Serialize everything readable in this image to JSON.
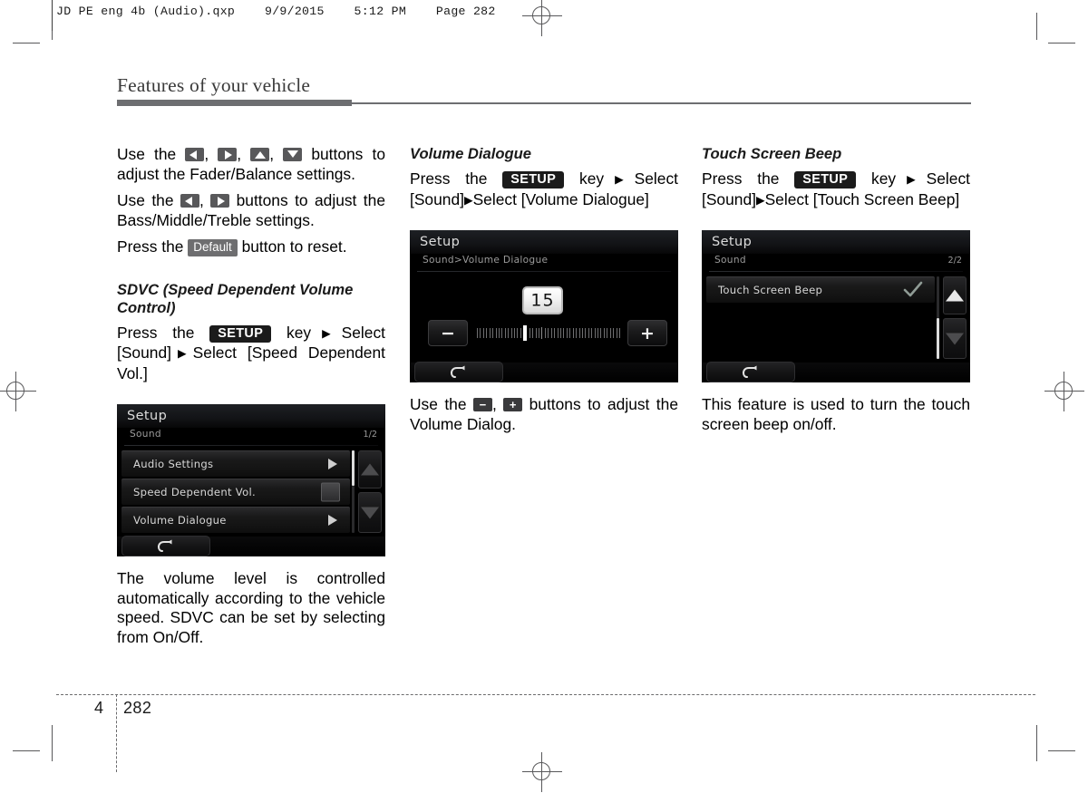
{
  "job_header": {
    "text": "JD PE eng 4b (Audio).qxp    9/9/2015    5:12 PM    Page 282"
  },
  "running_head": {
    "title": "Features of your vehicle"
  },
  "footer": {
    "chapter": "4",
    "page": "282"
  },
  "columns": {
    "col1": {
      "para1": {
        "t1": "Use the ",
        "sep1": ", ",
        "sep2": ", ",
        "sep3": ", ",
        "t2": " buttons to adjust the Fader/Balance settings."
      },
      "para2": {
        "t1": "Use the ",
        "sep1": ", ",
        "t2": " buttons to adjust the Bass/Middle/Treble settings."
      },
      "para3": {
        "t1": "Press the ",
        "chip": "Default",
        "t2": " button to reset."
      },
      "section_heading": "SDVC (Speed Dependent Volume Control)",
      "path": {
        "t1": "Press    the  ",
        "chip": "SETUP",
        "t2": "  key",
        "arrow1": "▶",
        "t3": "Select [Sound]",
        "arrow2": "▶",
        "t4": "Select [Speed Dependent Vol.]"
      },
      "caption": "The volume level is controlled automatically according to the vehicle speed. SDVC can be set by selecting from On/Off."
    },
    "col2": {
      "section_heading": "Volume Dialogue",
      "path": {
        "t1": "Press    the  ",
        "chip": "SETUP",
        "t2": "  key",
        "arrow1": "▶",
        "t3": "Select [Sound]",
        "arrow2": "▶",
        "t4": "Select [Volume Dialogue]"
      },
      "caption": {
        "t1": "Use the ",
        "sep1": ", ",
        "t2": " buttons to adjust the Volume Dialog."
      }
    },
    "col3": {
      "section_heading": "Touch Screen Beep",
      "path": {
        "t1": "Press    the  ",
        "chip": "SETUP",
        "t2": "  key",
        "arrow1": "▶",
        "t3": "Select [Sound]",
        "arrow2": "▶",
        "t4": "Select [Touch Screen Beep]"
      },
      "caption": "This feature is used to turn the touch screen beep on/off."
    }
  },
  "screens": {
    "sdvc": {
      "title": "Setup",
      "subtitle": "Sound",
      "page_indicator": "1/2",
      "rows": [
        {
          "label": "Audio Settings",
          "control": "caret"
        },
        {
          "label": "Speed Dependent Vol.",
          "control": "checkbox"
        },
        {
          "label": "Volume Dialogue",
          "control": "caret"
        }
      ],
      "nav_up": "scroll-up",
      "nav_down": "scroll-down",
      "back": "back"
    },
    "volume_dialogue": {
      "title": "Setup",
      "subtitle": "Sound>Volume Dialogue",
      "value": "15",
      "minus": "−",
      "plus": "+",
      "slider": {
        "min": 0,
        "max": 45,
        "value": 15,
        "ticks": 46
      },
      "back": "back"
    },
    "touch_screen_beep": {
      "title": "Setup",
      "subtitle": "Sound",
      "page_indicator": "2/2",
      "rows": [
        {
          "label": "Touch Screen Beep",
          "control": "check"
        }
      ],
      "nav_up": "scroll-up",
      "nav_down": "scroll-down",
      "back": "back"
    }
  }
}
